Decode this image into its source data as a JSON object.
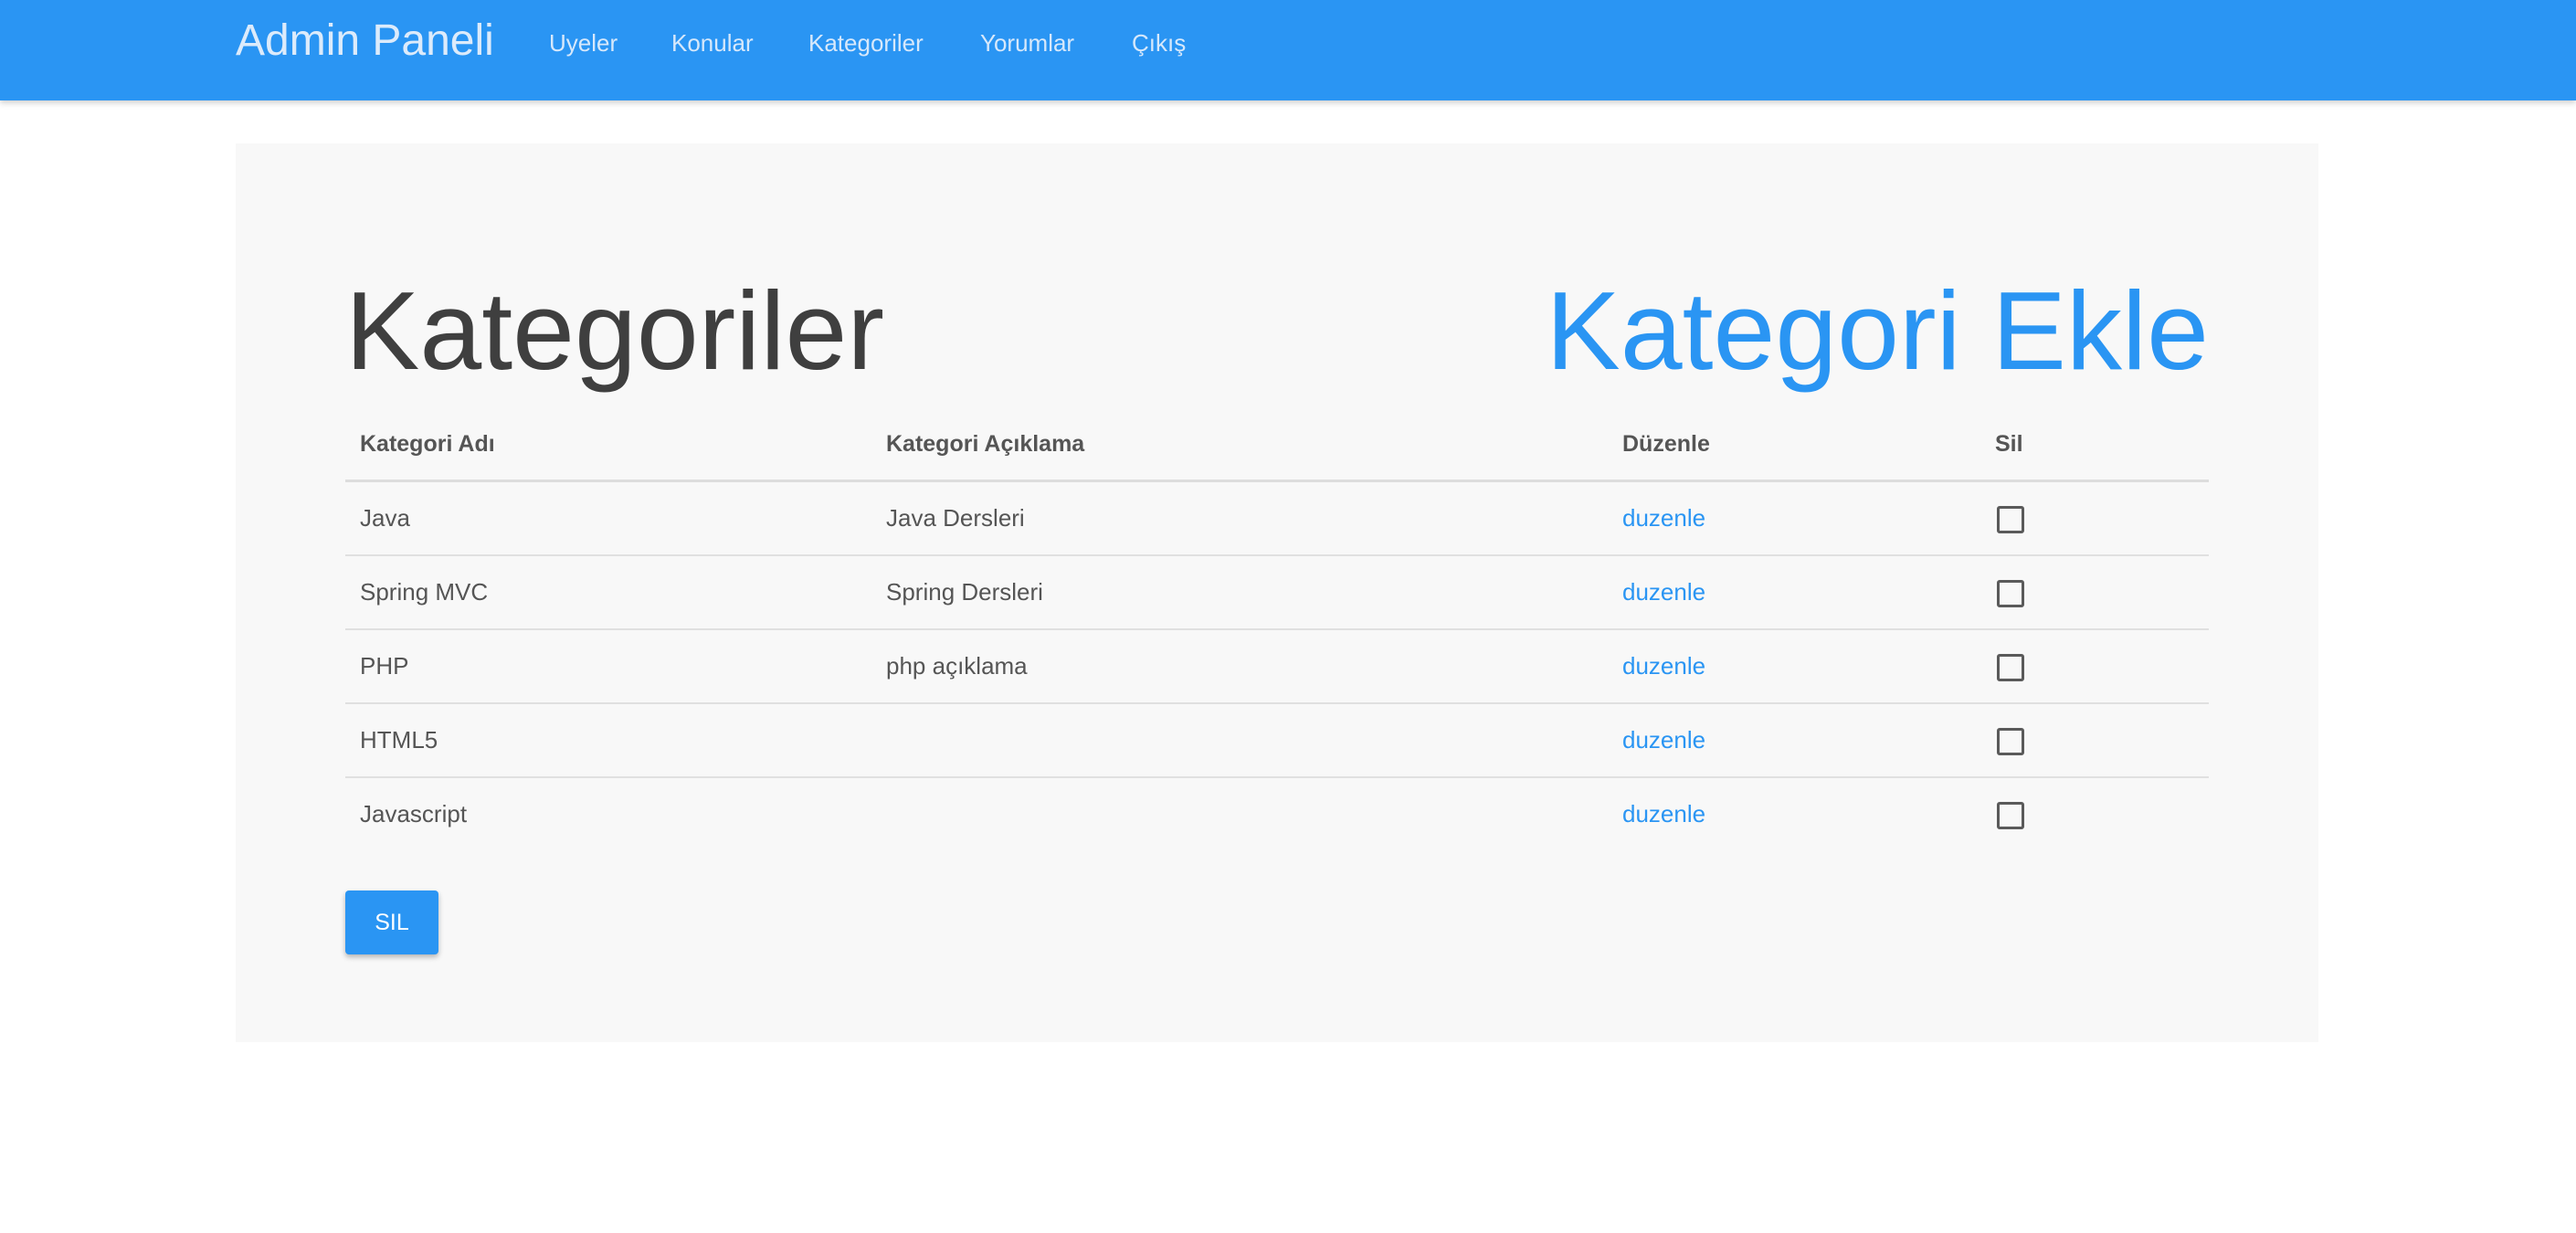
{
  "navbar": {
    "brand": "Admin Paneli",
    "links": [
      {
        "label": "Uyeler"
      },
      {
        "label": "Konular"
      },
      {
        "label": "Kategoriler"
      },
      {
        "label": "Yorumlar"
      },
      {
        "label": "Çıkış"
      }
    ],
    "bg_color": "#2a95f3"
  },
  "main": {
    "title": "Kategoriler",
    "add_link": "Kategori Ekle",
    "table": {
      "headers": [
        "Kategori Adı",
        "Kategori Açıklama",
        "Düzenle",
        "Sil"
      ],
      "rows": [
        {
          "name": "Java",
          "description": "Java Dersleri",
          "edit": "duzenle",
          "checked": false
        },
        {
          "name": "Spring MVC",
          "description": "Spring Dersleri",
          "edit": "duzenle",
          "checked": false
        },
        {
          "name": "PHP",
          "description": "php açıklama",
          "edit": "duzenle",
          "checked": false
        },
        {
          "name": "HTML5",
          "description": "",
          "edit": "duzenle",
          "checked": false
        },
        {
          "name": "Javascript",
          "description": "",
          "edit": "duzenle",
          "checked": false
        }
      ]
    },
    "delete_button": "SIL"
  }
}
